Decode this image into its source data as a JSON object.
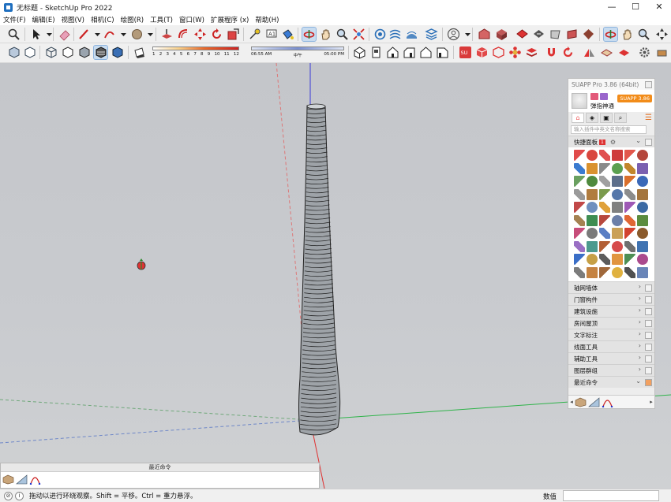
{
  "window": {
    "title": "无标题 - SketchUp Pro 2022",
    "minimize": "—",
    "maximize": "☐",
    "close": "✕"
  },
  "menu": [
    "文件(F)",
    "编辑(E)",
    "视图(V)",
    "相机(C)",
    "绘图(R)",
    "工具(T)",
    "窗口(W)",
    "扩展程序 (x)",
    "帮助(H)"
  ],
  "shadow_settings": {
    "month_ticks": [
      "1",
      "2",
      "3",
      "4",
      "5",
      "6",
      "7",
      "8",
      "9",
      "10",
      "11",
      "12"
    ],
    "time_start": "06:55 AM",
    "time_mid": "中午",
    "time_end": "05:00 PM"
  },
  "suapp": {
    "title": "SUAPP Pro 3.86 (64bit)",
    "user_name": "弹指神通",
    "version_badge": "SUAPP 3.86",
    "search_placeholder": "输入插件中英文名称搜索",
    "quick_panel": {
      "label": "快捷面板",
      "count": "1"
    },
    "categories": [
      "轴网墙体",
      "门窗构件",
      "建筑设施",
      "房间屋顶",
      "文字标注",
      "线面工具",
      "辅助工具",
      "图层群组",
      "最近命令"
    ],
    "icon_colors": [
      "#e14b4b",
      "#d9473f",
      "#e05050",
      "#cf3b3b",
      "#e2574c",
      "#b5463c",
      "#3b7bd0",
      "#d9912f",
      "#8a8a8a",
      "#5aa050",
      "#c2862c",
      "#7a5fb0",
      "#6aa060",
      "#4f8a3e",
      "#a0a0a0",
      "#5c6e8a",
      "#d96f2b",
      "#3a68b8",
      "#9a9a9a",
      "#b07c3f",
      "#7b9b4d",
      "#5577aa",
      "#8c8c8c",
      "#a4753e",
      "#c14848",
      "#6f8fbf",
      "#e0a13a",
      "#808080",
      "#9e59b5",
      "#3c6aa4",
      "#a58252",
      "#3e8d52",
      "#b7483d",
      "#6c7fa8",
      "#e06735",
      "#5b8c3e",
      "#c74d7a",
      "#7a7a7a",
      "#5b7fc4",
      "#caa056",
      "#d2422f",
      "#8a5a2c",
      "#9a6fc4",
      "#4c9a8e",
      "#b25f35",
      "#d64a4a",
      "#6f6f6f",
      "#3f73b2",
      "#3a6ec7",
      "#c6a046",
      "#5c5c5c",
      "#e19540",
      "#4d8f54",
      "#aa4a8d",
      "#7c7c7c",
      "#c58342",
      "#a0683a",
      "#e0b13f",
      "#505050",
      "#6985b8"
    ]
  },
  "recent_panel": {
    "title": "最近命令"
  },
  "statusbar": {
    "message": "拖动以进行环绕观察。Shift = 平移。Ctrl = 重力悬浮。",
    "measure_label": "数值",
    "measure_value": ""
  }
}
